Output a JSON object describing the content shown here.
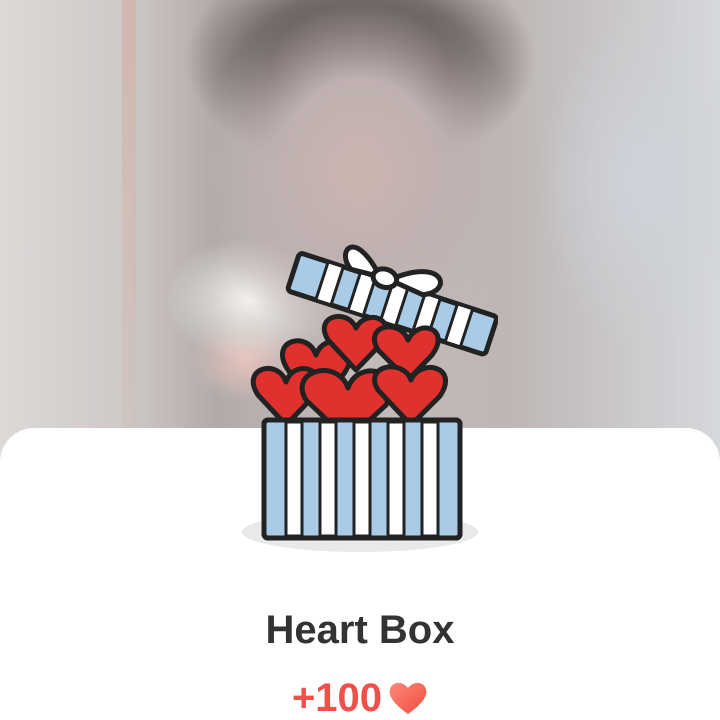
{
  "popup": {
    "gift_name": "Heart Box",
    "reward_amount": "+100",
    "reward_icon": "heart-icon"
  },
  "colors": {
    "reward_text": "#f14f4a",
    "title_text": "#333333",
    "box_blue": "#a9cbe6",
    "heart_red": "#e0312f"
  },
  "icons": {
    "gift": "gift-box-icon",
    "heart": "heart-icon"
  }
}
